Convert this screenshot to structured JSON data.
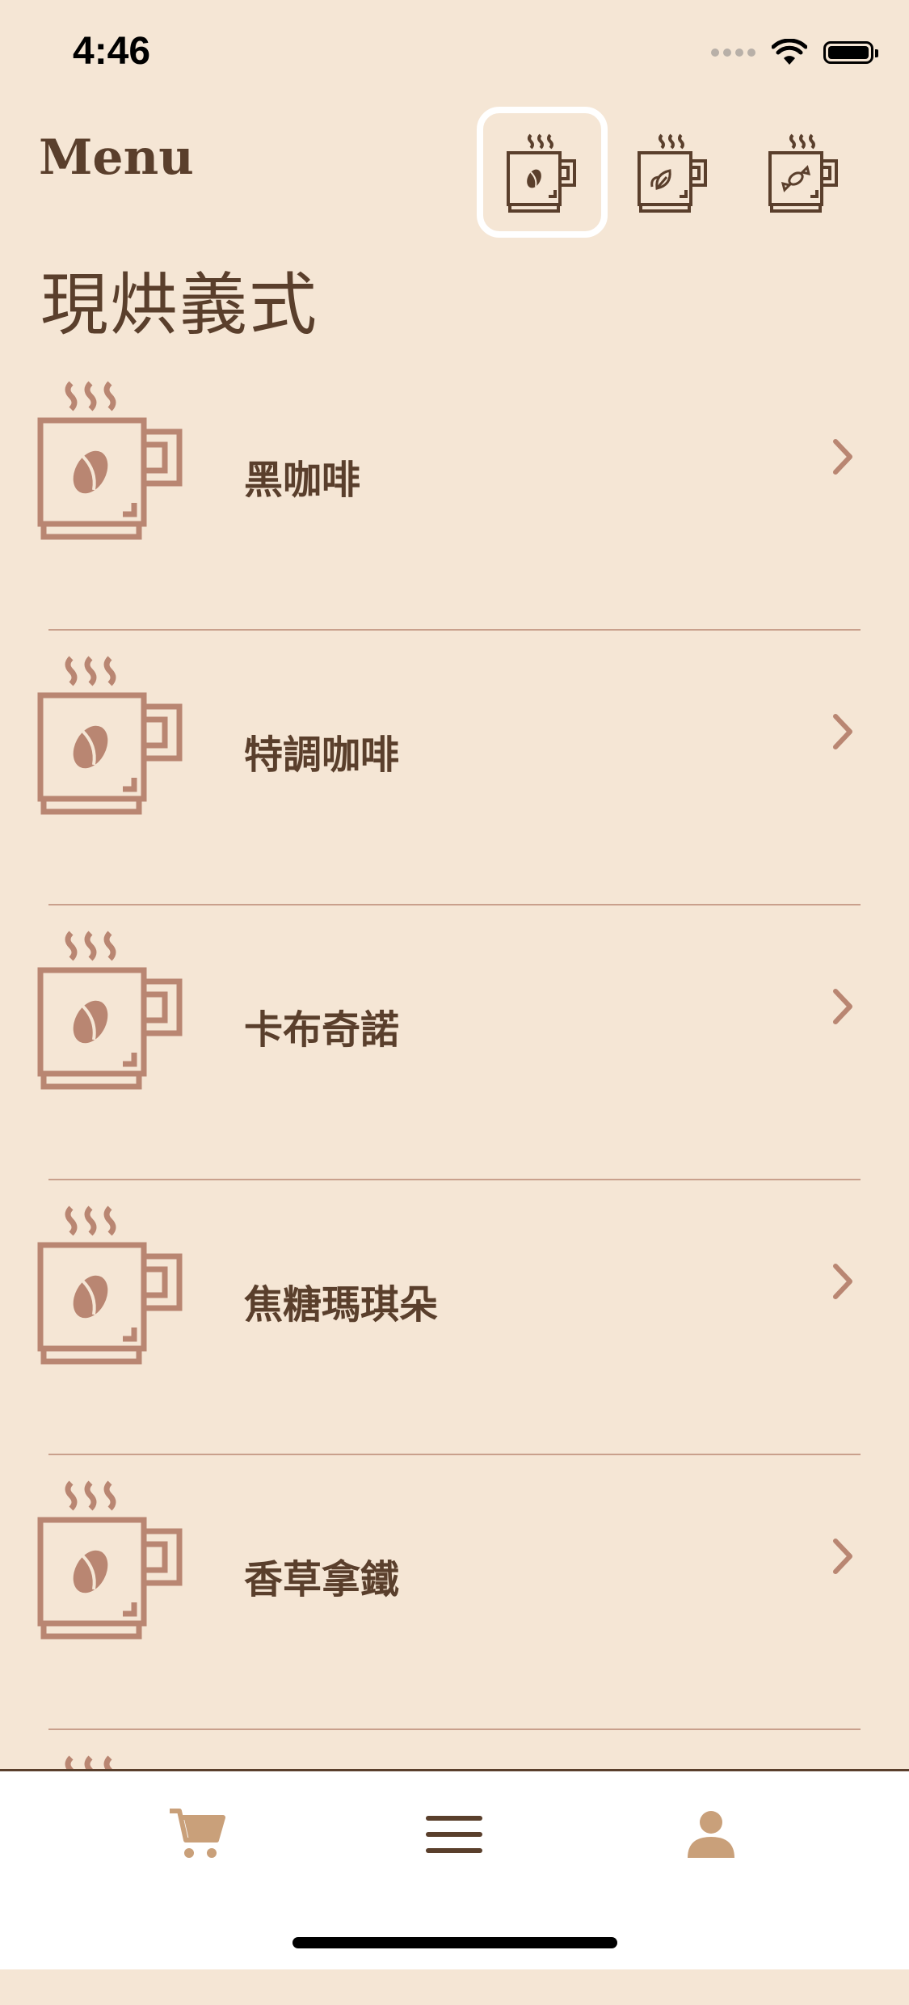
{
  "status_bar": {
    "time": "4:46"
  },
  "header": {
    "title": "Menu"
  },
  "category_tabs": [
    {
      "icon": "coffee-mug-bean-icon",
      "active": true
    },
    {
      "icon": "tea-mug-leaf-icon",
      "active": false
    },
    {
      "icon": "dessert-mug-candy-icon",
      "active": false
    }
  ],
  "section": {
    "title": "現烘義式"
  },
  "menu_items": [
    {
      "label": "黑咖啡",
      "icon": "coffee-mug-icon"
    },
    {
      "label": "特調咖啡",
      "icon": "coffee-mug-icon"
    },
    {
      "label": "卡布奇諾",
      "icon": "coffee-mug-icon"
    },
    {
      "label": "焦糖瑪琪朵",
      "icon": "coffee-mug-icon"
    },
    {
      "label": "香草拿鐵",
      "icon": "coffee-mug-icon"
    }
  ],
  "tab_bar": [
    {
      "name": "cart",
      "icon": "cart-icon",
      "color": "#c9a07a"
    },
    {
      "name": "menu",
      "icon": "hamburger-menu-icon",
      "color": "#5a3f2c"
    },
    {
      "name": "profile",
      "icon": "person-icon",
      "color": "#c9a07a"
    }
  ],
  "colors": {
    "background": "#f5e6d5",
    "accent": "#b98672",
    "text": "#5a3f2c"
  }
}
